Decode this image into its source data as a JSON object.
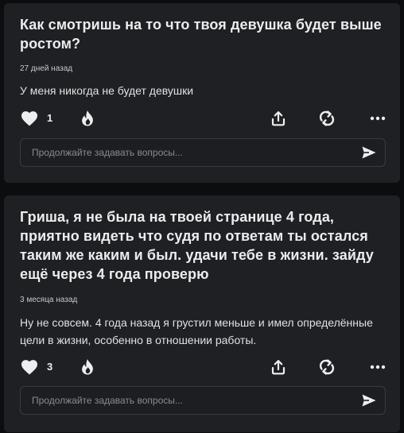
{
  "feed": {
    "cards": [
      {
        "question": "Как смотришь на то что твоя девушка будет выше ростом?",
        "time": "27 дней назад",
        "answer": "У меня никогда не будет девушки",
        "likes": "1",
        "ask_placeholder": "Продолжайте задавать вопросы..."
      },
      {
        "question": "Гриша, я не была на твоей странице 4 года, приятно видеть что судя по ответам ты остался таким же каким и был. удачи тебе в жизни. зайду ещё через 4 года проверю",
        "time": "3 месяца назад",
        "answer": "Ну не совсем. 4 года назад я грустил меньше и имел определённые цели в жизни, особенно в отношении работы.",
        "likes": "3",
        "ask_placeholder": "Продолжайте задавать вопросы..."
      }
    ]
  },
  "icons": {
    "like": "heart-icon",
    "fire": "fire-icon",
    "share": "share-icon",
    "repost": "repost-icon",
    "more": "more-icon",
    "send": "send-icon"
  },
  "colors": {
    "background": "#0c0d0f",
    "card": "#1f2023",
    "text_primary": "#ececee",
    "text_secondary": "#c6c7ca",
    "placeholder": "#8a8b8f",
    "input_border": "#3a3b3f"
  }
}
